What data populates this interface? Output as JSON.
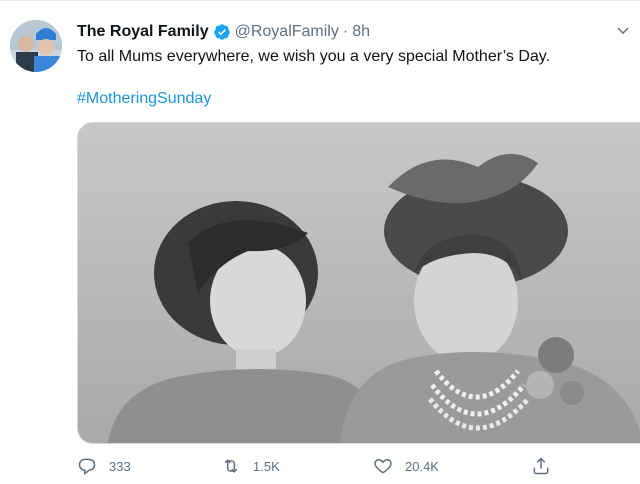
{
  "tweet": {
    "author_name": "The Royal Family",
    "handle": "@RoyalFamily",
    "separator": "·",
    "time": "8h",
    "text": "To all Mums everywhere, we wish you a very special Mother’s Day.",
    "hashtag": "#MotheringSunday"
  },
  "actions": {
    "replies": "333",
    "retweets": "1.5K",
    "likes": "20.4K"
  },
  "icons": {
    "verified": "verified-badge-icon",
    "caret": "chevron-down-icon",
    "reply": "reply-icon",
    "retweet": "retweet-icon",
    "like": "heart-icon",
    "share": "share-icon"
  },
  "colors": {
    "accent": "#1b95e0",
    "verified": "#1da1f2",
    "secondary_text": "#5b7083"
  }
}
